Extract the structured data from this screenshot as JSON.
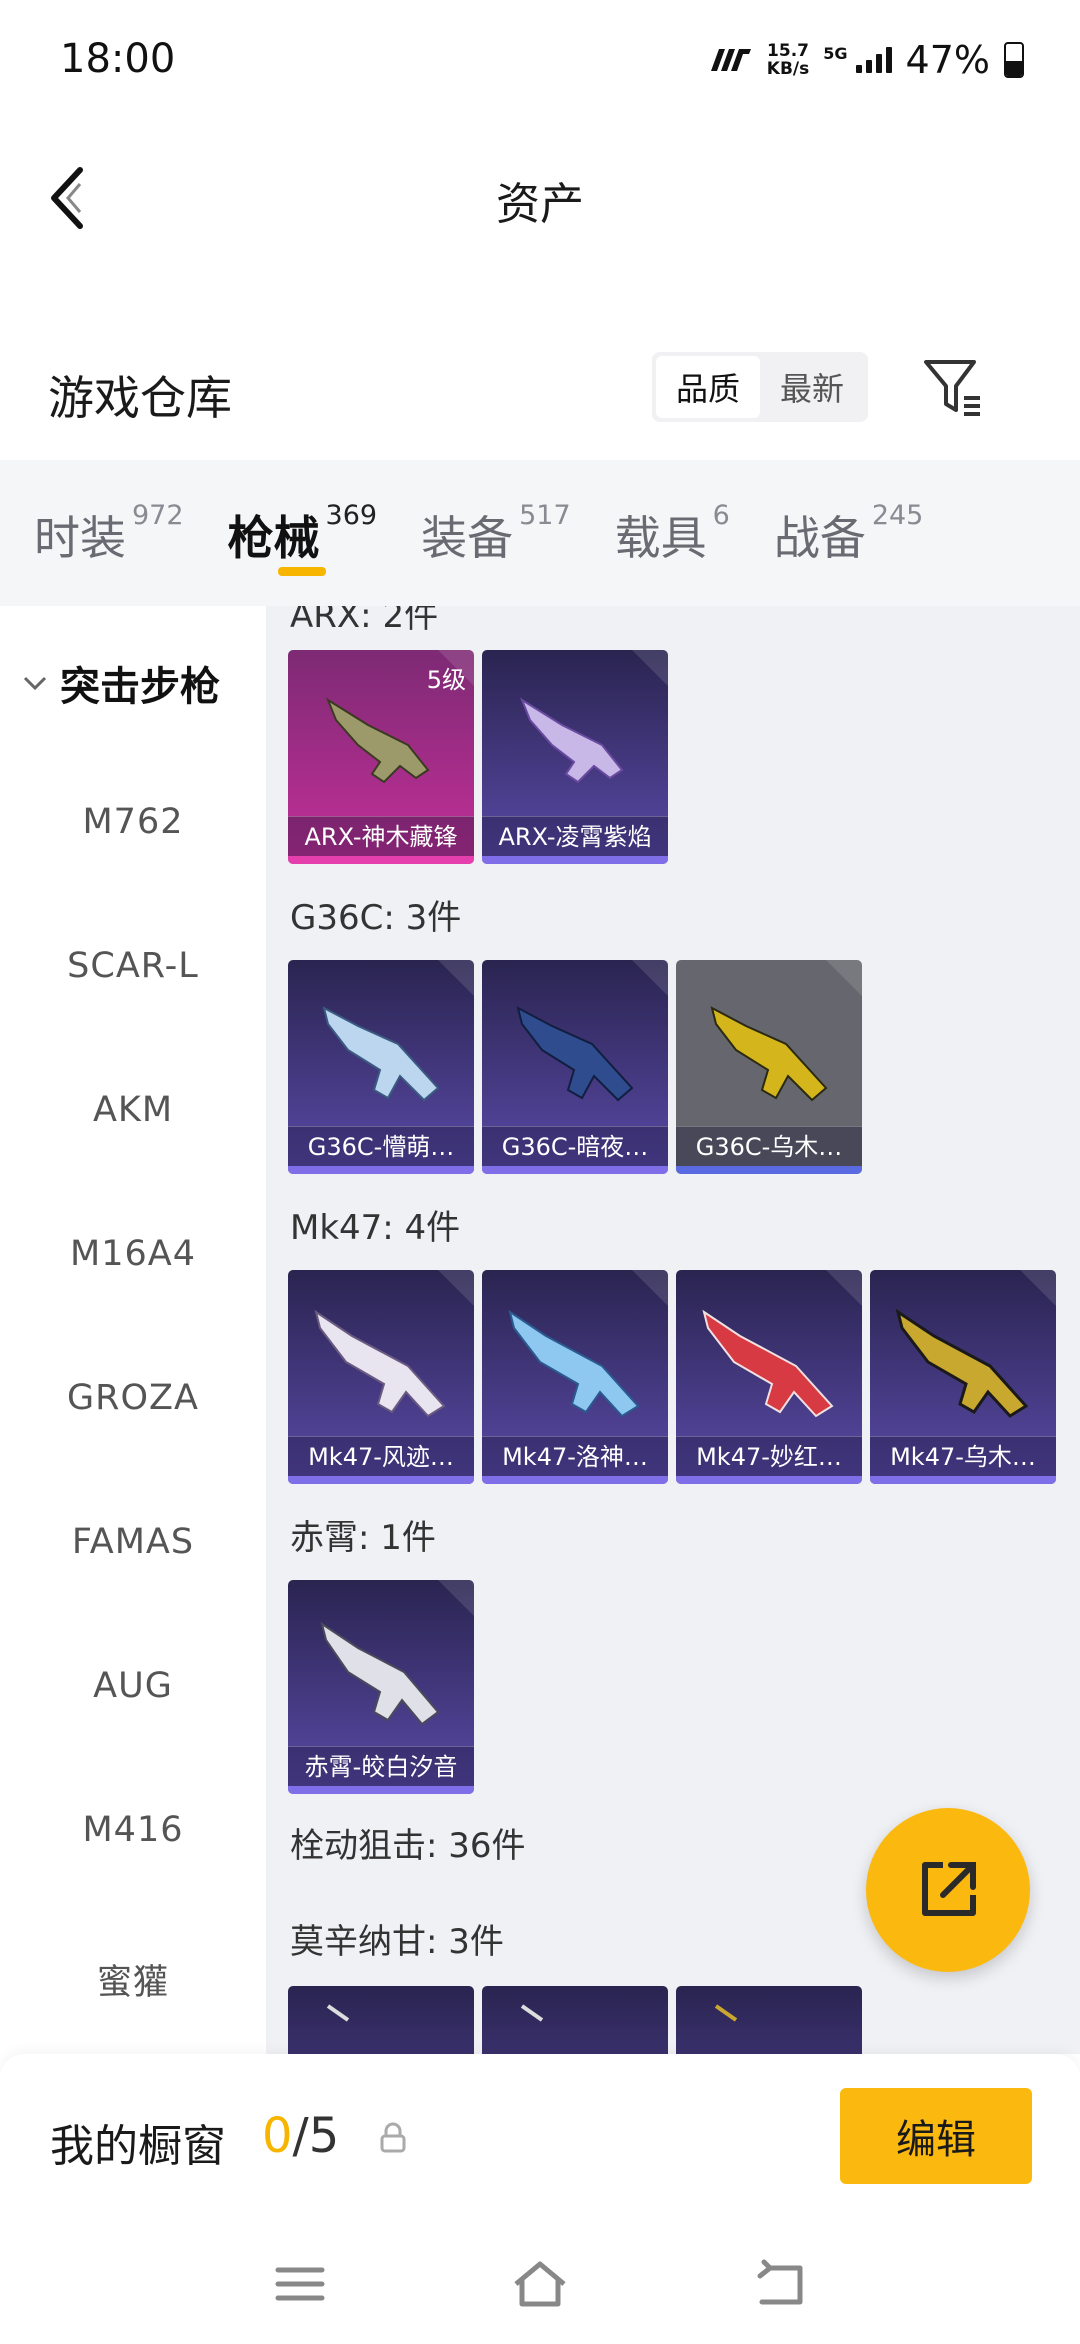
{
  "status": {
    "time": "18:00",
    "speed_value": "15.7",
    "speed_unit": "KB/s",
    "network": "5G",
    "battery_pct": "47%",
    "battery_level": 0.47
  },
  "nav": {
    "title": "资产",
    "back_icon": "chevron-left-icon"
  },
  "section": {
    "title": "游戏仓库",
    "sort": {
      "quality": "品质",
      "newest": "最新"
    },
    "filter_icon": "filter-icon"
  },
  "tabs": [
    {
      "label": "时装",
      "count": "972"
    },
    {
      "label": "枪械",
      "count": "369"
    },
    {
      "label": "装备",
      "count": "517"
    },
    {
      "label": "载具",
      "count": "6"
    },
    {
      "label": "战备",
      "count": "245"
    }
  ],
  "sidebar": {
    "group": "突击步枪",
    "items": [
      "M762",
      "SCAR-L",
      "AKM",
      "M16A4",
      "GROZA",
      "FAMAS",
      "AUG",
      "M416",
      "蜜獾"
    ]
  },
  "content": {
    "groups": [
      {
        "title": "ARX: 2件",
        "items": [
          {
            "name": "ARX-神木藏锋",
            "badge": "5级"
          },
          {
            "name": "ARX-凌霄紫焰"
          }
        ]
      },
      {
        "title": "G36C: 3件",
        "items": [
          {
            "name": "G36C-懵萌…"
          },
          {
            "name": "G36C-暗夜…"
          },
          {
            "name": "G36C-乌木…"
          }
        ]
      },
      {
        "title": "Mk47: 4件",
        "items": [
          {
            "name": "Mk47-风迹…"
          },
          {
            "name": "Mk47-洛神…"
          },
          {
            "name": "Mk47-妙红…"
          },
          {
            "name": "Mk47-乌木…"
          }
        ]
      },
      {
        "title": "赤霄: 1件",
        "items": [
          {
            "name": "赤霄-皎白汐音"
          }
        ]
      },
      {
        "title": "栓动狙击: 36件"
      },
      {
        "title": "莫辛纳甘: 3件"
      }
    ]
  },
  "colors": {
    "accent": "#fbb80f",
    "card_purple": "#3a2f6e",
    "card_pink": "#b22d8f",
    "card_gray": "#6a6a72"
  },
  "bottom": {
    "title": "我的橱窗",
    "count_current": "0",
    "count_total": "/5",
    "edit_label": "编辑"
  }
}
